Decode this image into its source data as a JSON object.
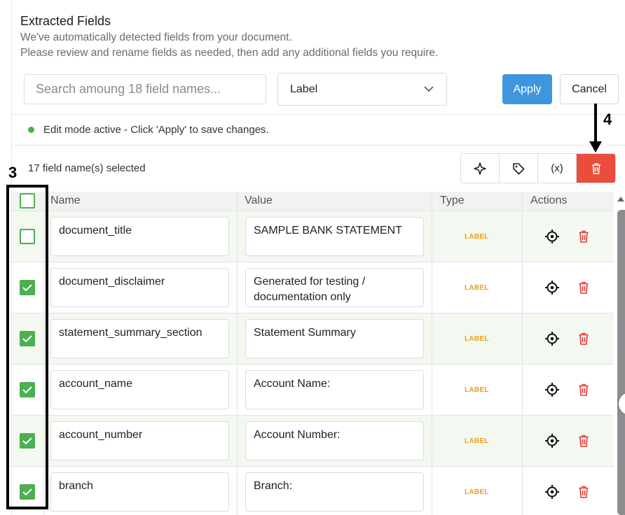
{
  "header": {
    "title": "Extracted Fields",
    "description_line1": "We've automatically detected fields from your document.",
    "description_line2": "Please review and rename fields as needed, then add any additional fields you require."
  },
  "search": {
    "placeholder": "Search amoung 18 field names...",
    "value": ""
  },
  "type_filter": {
    "selected": "Label"
  },
  "actions": {
    "apply_label": "Apply",
    "cancel_label": "Cancel"
  },
  "status": {
    "text": "Edit mode active - Click 'Apply' to save changes.",
    "dot_color": "#4caf50"
  },
  "selection": {
    "count_text": "17 field name(s) selected"
  },
  "toolbar": {
    "icons": [
      "sparkle-icon",
      "tag-icon",
      "variable-icon",
      "trash-icon"
    ],
    "variable_glyph": "(x)"
  },
  "table": {
    "columns": [
      "Name",
      "Value",
      "Type",
      "Actions"
    ],
    "rows": [
      {
        "name": "document_title",
        "value": "SAMPLE BANK STATEMENT",
        "type": "LABEL",
        "checked": false
      },
      {
        "name": "document_disclaimer",
        "value": "Generated for testing / documentation only",
        "type": "LABEL",
        "checked": true
      },
      {
        "name": "statement_summary_section",
        "value": "Statement Summary",
        "type": "LABEL",
        "checked": true
      },
      {
        "name": "account_name",
        "value": "Account Name:",
        "type": "LABEL",
        "checked": true
      },
      {
        "name": "account_number",
        "value": "Account Number:",
        "type": "LABEL",
        "checked": true
      },
      {
        "name": "branch",
        "value": "Branch:",
        "type": "LABEL",
        "checked": true
      }
    ]
  },
  "annotations": {
    "left_number": "3",
    "right_number": "4"
  },
  "colors": {
    "accent": "#3f96df",
    "danger": "#eb4d3d",
    "success": "#4caf50",
    "type_label": "#f39c12"
  }
}
